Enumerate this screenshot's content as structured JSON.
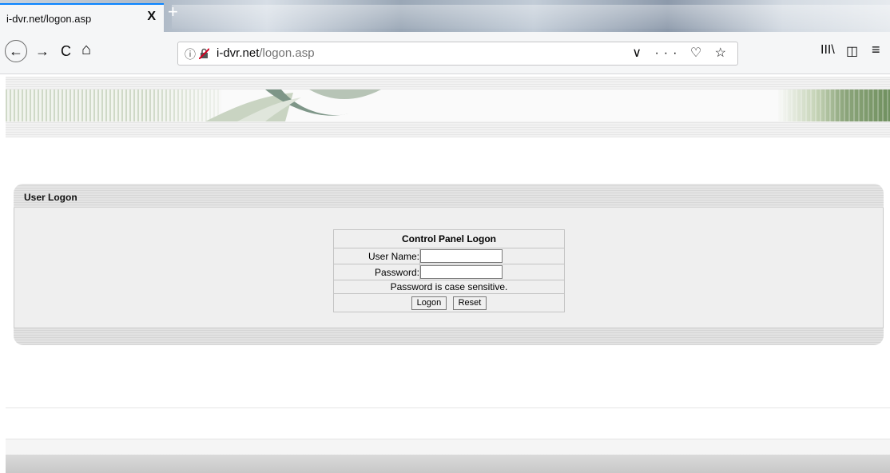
{
  "browser": {
    "tab_title": "i-dvr.net/logon.asp",
    "tab_close": "X",
    "new_tab": "+",
    "url_host": "i-dvr.net",
    "url_path": "/logon.asp",
    "nav": {
      "back": "←",
      "forward": "→",
      "reload": "C",
      "home": "⌂"
    },
    "url_actions": "∨ ··· ♡ ☆",
    "tools": {
      "library": "III\\",
      "sidebar": "◫",
      "menu": "≡"
    }
  },
  "panel": {
    "title": "User Logon"
  },
  "logon_form": {
    "title": "Control Panel Logon",
    "username_label": "User Name:",
    "username_value": "",
    "password_label": "Password:",
    "password_value": "",
    "note": "Password is case sensitive.",
    "logon_button": "Logon",
    "reset_button": "Reset"
  },
  "colors": {
    "tab_accent": "#0a84ff",
    "panel_body": "#efefef",
    "banner_green": "#8ca57b"
  }
}
